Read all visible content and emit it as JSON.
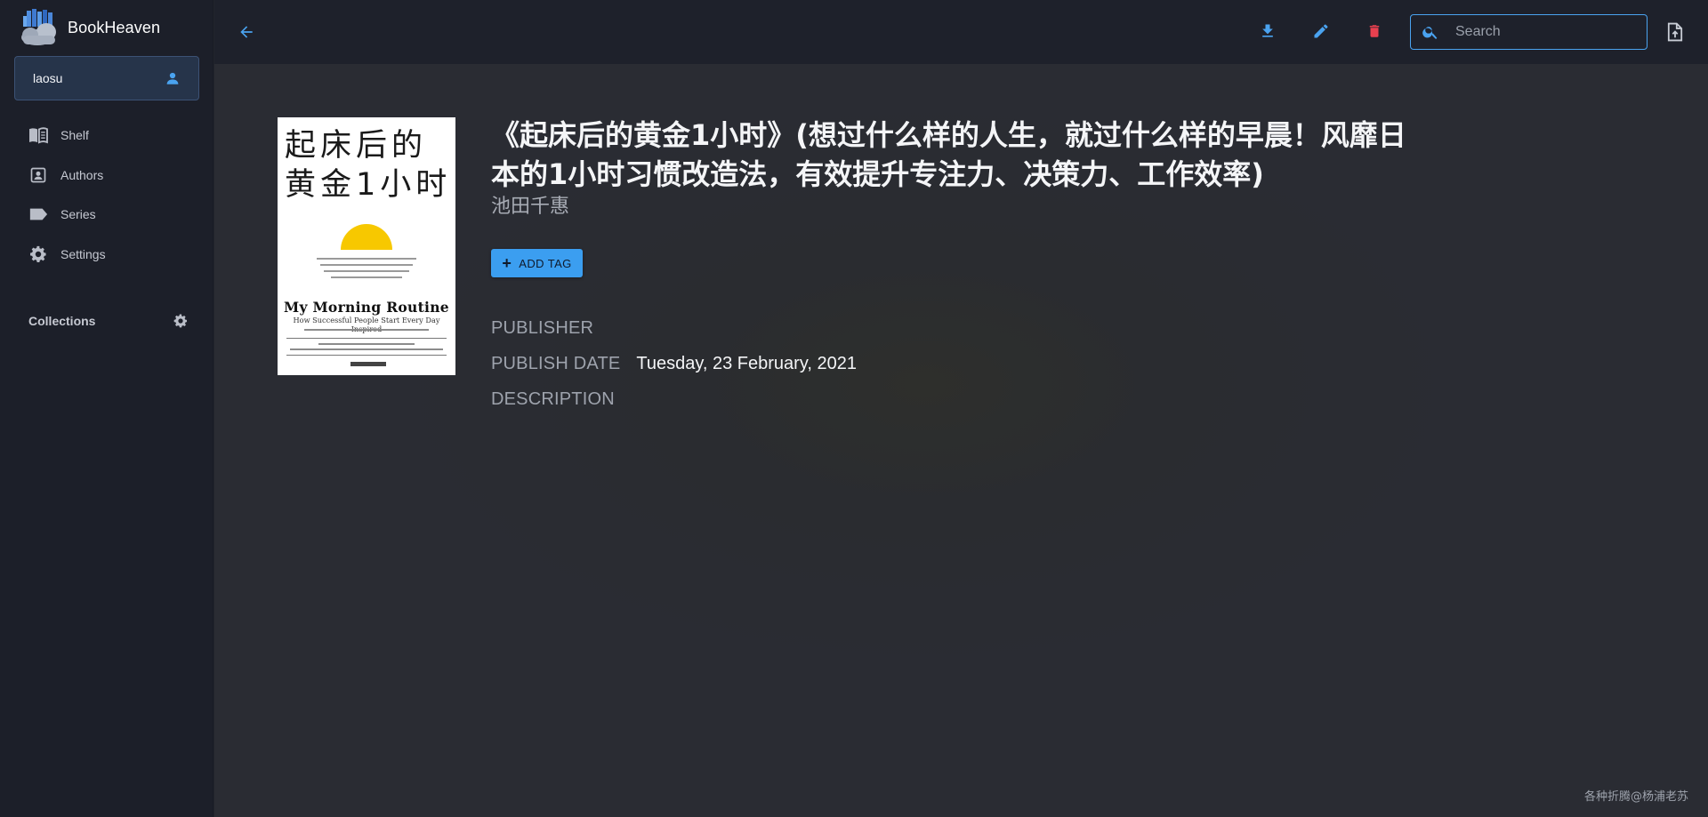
{
  "app": {
    "name": "BookHeaven"
  },
  "user": {
    "name": "laosu"
  },
  "sidebar": {
    "items": [
      {
        "label": "Shelf",
        "icon": "book-open-icon"
      },
      {
        "label": "Authors",
        "icon": "contact-card-icon"
      },
      {
        "label": "Series",
        "icon": "label-tag-icon"
      },
      {
        "label": "Settings",
        "icon": "gear-icon"
      }
    ],
    "collections_label": "Collections"
  },
  "toolbar": {
    "search_placeholder": "Search",
    "search_value": "",
    "download_icon": "download-icon",
    "edit_icon": "pencil-icon",
    "delete_icon": "trash-icon",
    "upload_icon": "upload-file-icon",
    "back_icon": "arrow-left-icon"
  },
  "book": {
    "title": "《起床后的黄金1小时》(想过什么样的人生，就过什么样的早晨！风靡日本的1小时习惯改造法，有效提升专注力、决策力、工作效率)",
    "author": "池田千惠",
    "cover": {
      "title_line1": "起床后的",
      "title_line2": "黄金1小时",
      "english_title": "My Morning Routine",
      "english_subtitle": "How Successful People Start Every Day Inspired"
    },
    "add_tag_label": "ADD TAG",
    "publisher_label": "PUBLISHER",
    "publisher_value": "",
    "publish_date_label": "PUBLISH DATE",
    "publish_date_value": "Tuesday, 23 February, 2021",
    "description_label": "DESCRIPTION",
    "description_value": ""
  },
  "watermark": "各种折腾@杨浦老苏",
  "colors": {
    "accent": "#3b9ef0",
    "delete": "#e8404f",
    "sidebar_bg": "#1c1f29",
    "main_bg": "#2a2c33"
  }
}
